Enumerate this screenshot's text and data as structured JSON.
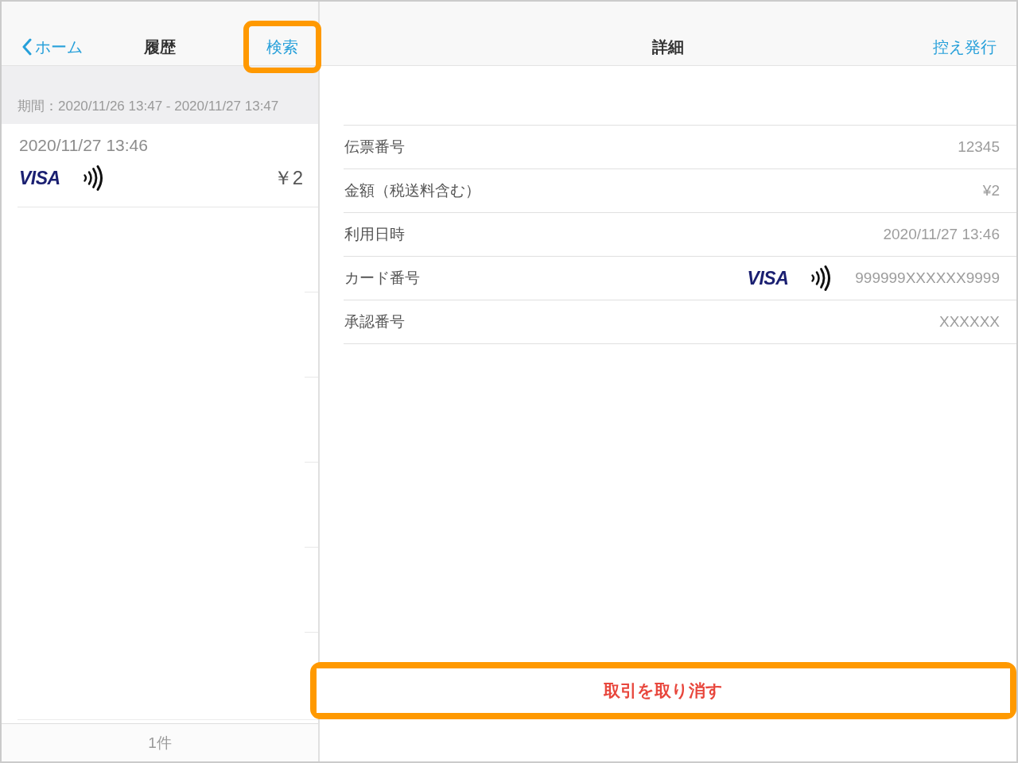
{
  "left_pane": {
    "nav_bar": {
      "back": {
        "label": "ホーム"
      },
      "title": "履歴",
      "action": {
        "label": "検索",
        "highlighted": true
      }
    },
    "period": "期間：2020/11/26 13:47 - 2020/11/27 13:47",
    "transactions": [
      {
        "datetime": "2020/11/27 13:46",
        "card_brand": "VISA",
        "contactless": true,
        "amount": "￥2",
        "selected": false
      }
    ],
    "footer": {
      "count": "1件"
    }
  },
  "right_pane": {
    "nav_bar": {
      "title": "詳細",
      "action": {
        "label": "控え発行",
        "highlighted": false
      }
    },
    "details": [
      {
        "kind": "text",
        "label": "伝票番号",
        "value": "12345"
      },
      {
        "kind": "text",
        "label": "金額（税送料含む）",
        "value": "¥2"
      },
      {
        "kind": "text",
        "label": "利用日時",
        "value": "2020/11/27 13:46"
      },
      {
        "kind": "card",
        "label": "カード番号",
        "card_brand": "VISA",
        "contactless": true,
        "value": "999999XXXXXX9999"
      },
      {
        "kind": "text",
        "label": "承認番号",
        "value": "XXXXXX"
      }
    ],
    "cancel_button": {
      "label": "取引を取り消す",
      "highlighted": true
    }
  }
}
